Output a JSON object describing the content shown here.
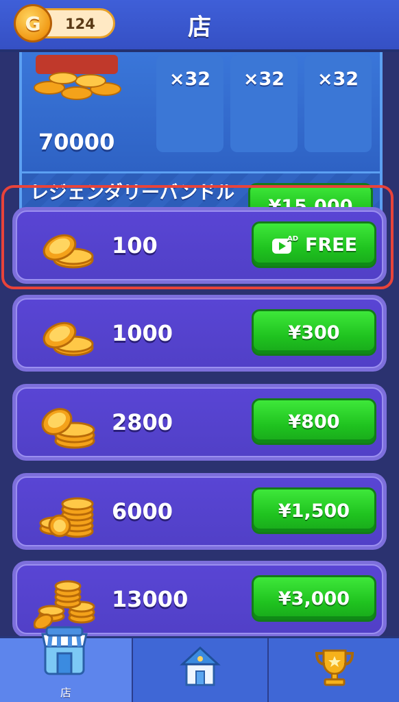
{
  "header": {
    "coin_count": "124",
    "coin_letter": "G",
    "title": "店"
  },
  "bundle": {
    "coin_amount": "70000",
    "item_counts": [
      "×32",
      "×32",
      "×32"
    ],
    "name": "レジェンダリーバンドル",
    "price": "¥15,000"
  },
  "offers": [
    {
      "amount": "100",
      "price": "FREE",
      "ad_badge": "AD",
      "icon": "coin-stack-small-icon"
    },
    {
      "amount": "1000",
      "price": "¥300",
      "icon": "coin-stack-small-icon"
    },
    {
      "amount": "2800",
      "price": "¥800",
      "icon": "coin-stack-medium-icon"
    },
    {
      "amount": "6000",
      "price": "¥1,500",
      "icon": "coin-stack-large-icon"
    },
    {
      "amount": "13000",
      "price": "¥3,000",
      "icon": "coin-pile-icon"
    }
  ],
  "nav": {
    "items": [
      {
        "label": "店",
        "icon": "shop-icon",
        "active": true
      },
      {
        "label": "",
        "icon": "home-icon",
        "active": false
      },
      {
        "label": "",
        "icon": "trophy-icon",
        "active": false
      }
    ]
  },
  "colors": {
    "header_bg": "#3f5fd8",
    "page_bg": "#2b3270",
    "row_bg": "#5945d4",
    "button_green": "#1fc21f",
    "highlight_red": "#e8433a",
    "coin_gold": "#f5a623"
  }
}
